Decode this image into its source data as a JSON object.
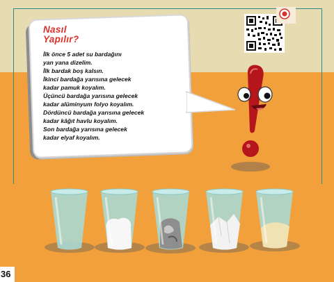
{
  "title_line1": "Nasıl",
  "title_line2": "Yapılır?",
  "instructions": [
    "İlk önce 5 adet su bardağını",
    "yan yana dizelim.",
    "İlk bardak boş kalsın.",
    "İkinci bardağa yarısına gelecek",
    "kadar pamuk koyalım.",
    "Üçüncü bardağa yarısına gelecek",
    "kadar alüminyum folyo koyalım.",
    "Dördüncü bardağa yarısına gelecek",
    "kadar kâğıt havlu koyalım.",
    "Son bardağa yarısına gelecek",
    "kadar elyaf koyalım."
  ],
  "page_number": "36",
  "qr_icon": "qr-code-icon",
  "colors": {
    "wall": "#e7dbb2",
    "floor": "#f2a03b",
    "title": "#d8312a",
    "mascot": "#b5161c",
    "glass": "#a8dcdb"
  }
}
